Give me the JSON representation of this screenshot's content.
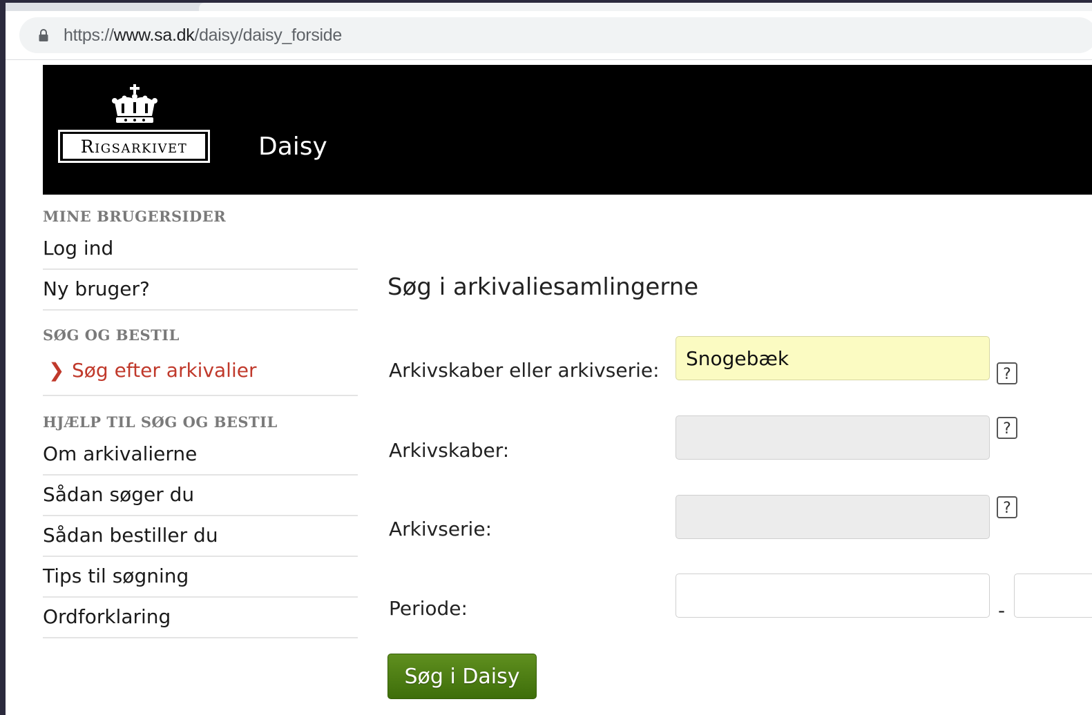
{
  "browser": {
    "url_scheme": "https://",
    "url_host": "www.sa.dk",
    "url_path": "/daisy/daisy_forside"
  },
  "header": {
    "logo_text": "Rigsarkivet",
    "site_title": "Daisy"
  },
  "sidebar": {
    "sections": [
      {
        "heading": "MINE BRUGERSIDER",
        "items": [
          "Log ind",
          "Ny bruger?"
        ]
      },
      {
        "heading": "SØG OG BESTIL",
        "items": [
          "Søg efter arkivalier"
        ]
      },
      {
        "heading": "HJÆLP TIL SØG OG BESTIL",
        "items": [
          "Om arkivalierne",
          "Sådan søger du",
          "Sådan bestiller du",
          "Tips til søgning",
          "Ordforklaring"
        ]
      }
    ],
    "active_item": "Søg efter arkivalier"
  },
  "main": {
    "title": "Søg i arkivaliesamlingerne",
    "fields": [
      {
        "label": "Arkivskaber eller arkivserie:",
        "value": "Snogebæk"
      },
      {
        "label": "Arkivskaber:",
        "value": ""
      },
      {
        "label": "Arkivserie:",
        "value": ""
      },
      {
        "label": "Periode:",
        "value": ""
      }
    ],
    "period_separator": "-",
    "help_symbol": "?",
    "search_button": "Søg i Daisy"
  },
  "colors": {
    "header_bg": "#000000",
    "active_nav": "#c0392b",
    "button_green": "#4a7a12",
    "highlight_field": "#fbfbc2"
  }
}
